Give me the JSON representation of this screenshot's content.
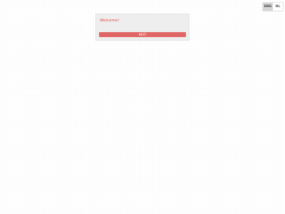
{
  "language_switch": {
    "options": [
      {
        "label": "ENG",
        "active": true
      },
      {
        "label": "NL",
        "active": false
      }
    ]
  },
  "welcome_card": {
    "title": "Welcome!",
    "next_label": "NEXT"
  },
  "colors": {
    "accent": "#e06666",
    "title": "#d9534f",
    "card_bg": "#eeeeee"
  }
}
